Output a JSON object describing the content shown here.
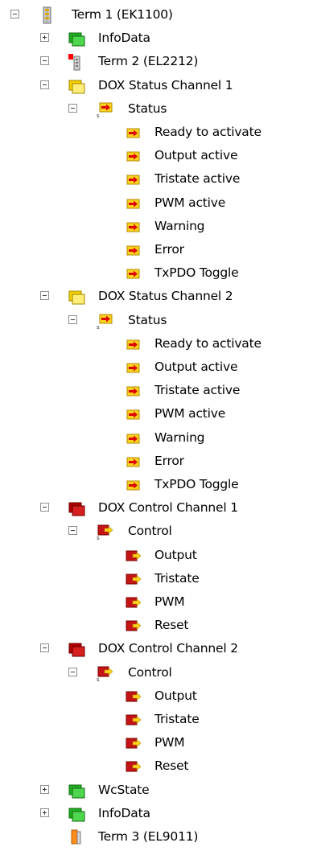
{
  "tree": {
    "nodes": [
      {
        "id": "term1",
        "label": "Term 1 (EK1100)",
        "depth": 0,
        "expander": "expanded",
        "icon": "coupler-icon"
      },
      {
        "id": "term1-infodata",
        "label": "InfoData",
        "depth": 1,
        "expander": "collapsed",
        "icon": "green-folder-icon"
      },
      {
        "id": "term2",
        "label": "Term 2 (EL2212)",
        "depth": 1,
        "expander": "expanded",
        "icon": "terminal-red-icon"
      },
      {
        "id": "dox-status-1",
        "label": "DOX Status Channel 1",
        "depth": 2,
        "expander": "expanded",
        "icon": "yellow-folder-icon"
      },
      {
        "id": "dox-status-1-status",
        "label": "Status",
        "depth": 3,
        "expander": "expanded",
        "icon": "input-var-group-icon"
      },
      {
        "id": "ds1-ready",
        "label": "Ready to activate",
        "depth": 4,
        "expander": "none",
        "icon": "input-var-icon"
      },
      {
        "id": "ds1-output-active",
        "label": "Output active",
        "depth": 4,
        "expander": "none",
        "icon": "input-var-icon"
      },
      {
        "id": "ds1-tristate-active",
        "label": "Tristate active",
        "depth": 4,
        "expander": "none",
        "icon": "input-var-icon"
      },
      {
        "id": "ds1-pwm-active",
        "label": "PWM active",
        "depth": 4,
        "expander": "none",
        "icon": "input-var-icon"
      },
      {
        "id": "ds1-warning",
        "label": "Warning",
        "depth": 4,
        "expander": "none",
        "icon": "input-var-icon"
      },
      {
        "id": "ds1-error",
        "label": "Error",
        "depth": 4,
        "expander": "none",
        "icon": "input-var-icon"
      },
      {
        "id": "ds1-txpdo-toggle",
        "label": "TxPDO Toggle",
        "depth": 4,
        "expander": "none",
        "icon": "input-var-icon"
      },
      {
        "id": "dox-status-2",
        "label": "DOX Status Channel 2",
        "depth": 2,
        "expander": "expanded",
        "icon": "yellow-folder-icon"
      },
      {
        "id": "dox-status-2-status",
        "label": "Status",
        "depth": 3,
        "expander": "expanded",
        "icon": "input-var-group-icon"
      },
      {
        "id": "ds2-ready",
        "label": "Ready to activate",
        "depth": 4,
        "expander": "none",
        "icon": "input-var-icon"
      },
      {
        "id": "ds2-output-active",
        "label": "Output active",
        "depth": 4,
        "expander": "none",
        "icon": "input-var-icon"
      },
      {
        "id": "ds2-tristate-active",
        "label": "Tristate active",
        "depth": 4,
        "expander": "none",
        "icon": "input-var-icon"
      },
      {
        "id": "ds2-pwm-active",
        "label": "PWM active",
        "depth": 4,
        "expander": "none",
        "icon": "input-var-icon"
      },
      {
        "id": "ds2-warning",
        "label": "Warning",
        "depth": 4,
        "expander": "none",
        "icon": "input-var-icon"
      },
      {
        "id": "ds2-error",
        "label": "Error",
        "depth": 4,
        "expander": "none",
        "icon": "input-var-icon"
      },
      {
        "id": "ds2-txpdo-toggle",
        "label": "TxPDO Toggle",
        "depth": 4,
        "expander": "none",
        "icon": "input-var-icon"
      },
      {
        "id": "dox-control-1",
        "label": "DOX Control Channel 1",
        "depth": 2,
        "expander": "expanded",
        "icon": "red-folder-icon"
      },
      {
        "id": "dox-control-1-control",
        "label": "Control",
        "depth": 3,
        "expander": "expanded",
        "icon": "output-var-group-icon"
      },
      {
        "id": "dc1-output",
        "label": "Output",
        "depth": 4,
        "expander": "none",
        "icon": "output-var-icon"
      },
      {
        "id": "dc1-tristate",
        "label": "Tristate",
        "depth": 4,
        "expander": "none",
        "icon": "output-var-icon"
      },
      {
        "id": "dc1-pwm",
        "label": "PWM",
        "depth": 4,
        "expander": "none",
        "icon": "output-var-icon"
      },
      {
        "id": "dc1-reset",
        "label": "Reset",
        "depth": 4,
        "expander": "none",
        "icon": "output-var-icon"
      },
      {
        "id": "dox-control-2",
        "label": "DOX Control Channel 2",
        "depth": 2,
        "expander": "expanded",
        "icon": "red-folder-icon"
      },
      {
        "id": "dox-control-2-control",
        "label": "Control",
        "depth": 3,
        "expander": "expanded",
        "icon": "output-var-group-icon"
      },
      {
        "id": "dc2-output",
        "label": "Output",
        "depth": 4,
        "expander": "none",
        "icon": "output-var-icon"
      },
      {
        "id": "dc2-tristate",
        "label": "Tristate",
        "depth": 4,
        "expander": "none",
        "icon": "output-var-icon"
      },
      {
        "id": "dc2-pwm",
        "label": "PWM",
        "depth": 4,
        "expander": "none",
        "icon": "output-var-icon"
      },
      {
        "id": "dc2-reset",
        "label": "Reset",
        "depth": 4,
        "expander": "none",
        "icon": "output-var-icon"
      },
      {
        "id": "term2-wcstate",
        "label": "WcState",
        "depth": 1,
        "expander": "collapsed",
        "icon": "green-folder-icon"
      },
      {
        "id": "term2-infodata",
        "label": "InfoData",
        "depth": 1,
        "expander": "collapsed",
        "icon": "green-folder-icon"
      },
      {
        "id": "term3",
        "label": "Term 3 (EL9011)",
        "depth": 1,
        "expander": "none",
        "icon": "end-terminal-orange-icon"
      }
    ]
  }
}
